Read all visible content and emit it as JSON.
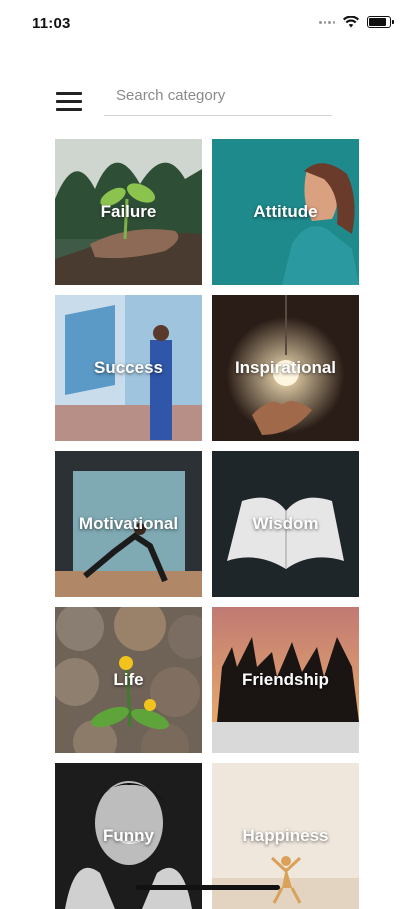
{
  "status_bar": {
    "time": "11:03"
  },
  "search": {
    "placeholder": "Search category"
  },
  "categories": [
    {
      "label": "Failure"
    },
    {
      "label": "Attitude"
    },
    {
      "label": "Success"
    },
    {
      "label": "Inspirational"
    },
    {
      "label": "Motivational"
    },
    {
      "label": "Wisdom"
    },
    {
      "label": "Life"
    },
    {
      "label": "Friendship"
    },
    {
      "label": "Funny"
    },
    {
      "label": "Happiness"
    }
  ],
  "colors": {
    "accent_teal": "#1e8a8c",
    "text_dark": "#111111"
  }
}
